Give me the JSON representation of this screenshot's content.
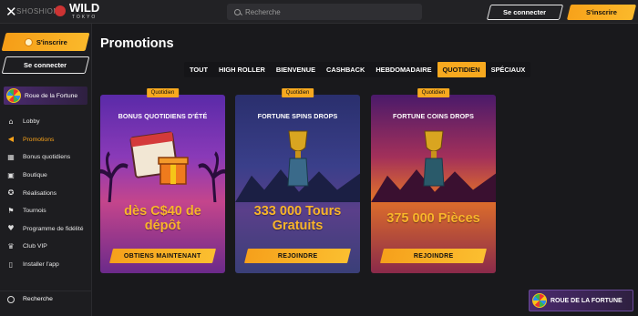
{
  "header": {
    "logo_watermark": "SHOSHIONE",
    "brand": "WILD",
    "brand_sub": "TOKYO",
    "search_placeholder": "Recherche",
    "connect_label": "Se connecter",
    "signup_label": "S'inscrire"
  },
  "sidebar": {
    "signup_label": "S'inscrire",
    "connect_label": "Se connecter",
    "wheel_label": "Roue de la Fortune",
    "items": [
      {
        "label": "Lobby",
        "icon": "home-icon",
        "active": false
      },
      {
        "label": "Promotions",
        "icon": "megaphone-icon",
        "active": true
      },
      {
        "label": "Bonus quotidiens",
        "icon": "calendar-icon",
        "active": false
      },
      {
        "label": "Boutique",
        "icon": "shop-icon",
        "active": false
      },
      {
        "label": "Réalisations",
        "icon": "trophy-icon",
        "active": false
      },
      {
        "label": "Tournois",
        "icon": "tournament-icon",
        "active": false
      },
      {
        "label": "Programme de fidélité",
        "icon": "loyalty-icon",
        "active": false
      },
      {
        "label": "Club VIP",
        "icon": "crown-icon",
        "active": false
      },
      {
        "label": "Installer l'app",
        "icon": "app-icon",
        "active": false
      }
    ],
    "search_label": "Recherche"
  },
  "main": {
    "title": "Promotions",
    "tabs": [
      {
        "label": "TOUT",
        "active": false
      },
      {
        "label": "HIGH ROLLER",
        "active": false
      },
      {
        "label": "BIENVENUE",
        "active": false
      },
      {
        "label": "CASHBACK",
        "active": false
      },
      {
        "label": "HEBDOMADAIRE",
        "active": false
      },
      {
        "label": "QUOTIDIEN",
        "active": true
      },
      {
        "label": "SPÉCIAUX",
        "active": false
      }
    ],
    "cards": [
      {
        "tag": "Quotidien",
        "title": "BONUS QUOTIDIENS D'ÉTÉ",
        "value_line1": "dès C$40 de",
        "value_line2": "dépôt",
        "cta": "OBTIENS MAINTENANT"
      },
      {
        "tag": "Quotidien",
        "title": "FORTUNE SPINS DROPS",
        "value_line1": "333 000 Tours",
        "value_line2": "Gratuits",
        "cta": "REJOINDRE"
      },
      {
        "tag": "Quotidien",
        "title": "FORTUNE COINS DROPS",
        "value_line1": "375 000 Pièces",
        "value_line2": "",
        "cta": "REJOINDRE"
      }
    ]
  },
  "floating": {
    "wheel_label": "ROUE DE LA FORTUNE"
  },
  "colors": {
    "accent": "#f7a91f",
    "background": "#19191c",
    "sidebar": "#1d1d20"
  }
}
